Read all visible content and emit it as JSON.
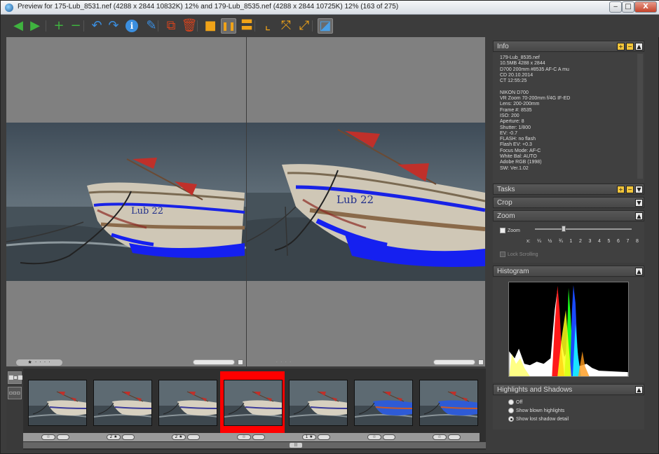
{
  "window": {
    "title": "Preview for 175-Lub_8531.nef (4288 x 2844 10832K) 12% and 179-Lub_8535.nef (4288 x 2844 10725K) 12% (163 of 275)",
    "minimize": "‒",
    "maximize": "□",
    "close": "X"
  },
  "toolbar": [
    {
      "name": "back-arrow-icon",
      "glyph": "◀",
      "color": "#3fb33f"
    },
    {
      "name": "forward-arrow-icon",
      "glyph": "▶",
      "color": "#3fb33f"
    },
    {
      "name": "zoom-in-icon",
      "glyph": "+",
      "color": "#3fb33f"
    },
    {
      "name": "zoom-out-icon",
      "glyph": "−",
      "color": "#3fb33f"
    },
    {
      "name": "rotate-left-icon",
      "glyph": "↶",
      "color": "#3b8fe0"
    },
    {
      "name": "rotate-right-icon",
      "glyph": "↷",
      "color": "#3b8fe0"
    },
    {
      "name": "info-icon",
      "glyph": "i",
      "color": "#3b8fe0"
    },
    {
      "name": "edit-icon",
      "glyph": "✎",
      "color": "#3b8fe0"
    },
    {
      "name": "copy-icon",
      "glyph": "⧉",
      "color": "#d2431e"
    },
    {
      "name": "delete-icon",
      "glyph": "🗑",
      "color": "#d2431e"
    },
    {
      "name": "single-view-icon",
      "glyph": "■",
      "color": "#f0a318"
    },
    {
      "name": "compare-vertical-icon",
      "glyph": "❚❚",
      "color": "#f0a318"
    },
    {
      "name": "compare-horizontal-icon",
      "glyph": "〓",
      "color": "#f0a318"
    },
    {
      "name": "crop-icon",
      "glyph": "⌞",
      "color": "#f0a318"
    },
    {
      "name": "fit-window-icon",
      "glyph": "⤧",
      "color": "#f0a318"
    },
    {
      "name": "full-screen-icon",
      "glyph": "⤢",
      "color": "#f0a318"
    },
    {
      "name": "color-profile-icon",
      "glyph": "◪",
      "color": "#4aa0e6"
    }
  ],
  "viewers": {
    "left": {
      "rating": "★ · · · ·"
    },
    "right": {
      "rating": "· · · ·"
    }
  },
  "filmstrip": {
    "thumbs": [
      {
        "rating": "☆",
        "selected": false,
        "tint": "gray"
      },
      {
        "rating": "2 ★",
        "selected": false,
        "tint": "gray"
      },
      {
        "rating": "2 ★",
        "selected": false,
        "tint": "gray"
      },
      {
        "rating": "☆",
        "selected": true,
        "tint": "gray"
      },
      {
        "rating": "1 ★",
        "selected": false,
        "tint": "gray"
      },
      {
        "rating": "☆",
        "selected": false,
        "tint": "blue"
      },
      {
        "rating": "☆",
        "selected": false,
        "tint": "blue"
      }
    ],
    "scroll_label": "|||"
  },
  "panel": {
    "info": {
      "title": "Info",
      "lines": [
        "179-Lub_8535.nef",
        "10.5MB   4288 x 2844",
        "D700 200mm #8535 AF-C A mu",
        "CD 20.10.2014",
        "CT 12:55:25",
        "",
        "NIKON D700",
        "VR Zoom 70-200mm f/4G IF-ED",
        "Lens:  200-200mm",
        "Frame #: 8535",
        "ISO: 200",
        "Aperture: 8",
        "Shutter: 1/800",
        "EV: -0.7",
        "FLASH: no flash",
        "Flash EV: +0.3",
        "Focus Mode: AF-C",
        "White Bal: AUTO",
        "Adobe RGB (1998)",
        "SW: Ver.1.02"
      ]
    },
    "tasks": {
      "title": "Tasks"
    },
    "crop": {
      "title": "Crop"
    },
    "zoom": {
      "title": "Zoom",
      "zoom_label": "Zoom",
      "levels": [
        "x:",
        "¼",
        "½",
        "¾",
        "1",
        "2",
        "3",
        "4",
        "5",
        "6",
        "7",
        "8"
      ],
      "lock_label": "Lock Scrolling"
    },
    "histogram": {
      "title": "Histogram"
    },
    "highlights": {
      "title": "Highlights and Shadows",
      "options": [
        "Off",
        "Show blown highlights",
        "Show lost shadow detail"
      ],
      "selected": 2
    }
  }
}
